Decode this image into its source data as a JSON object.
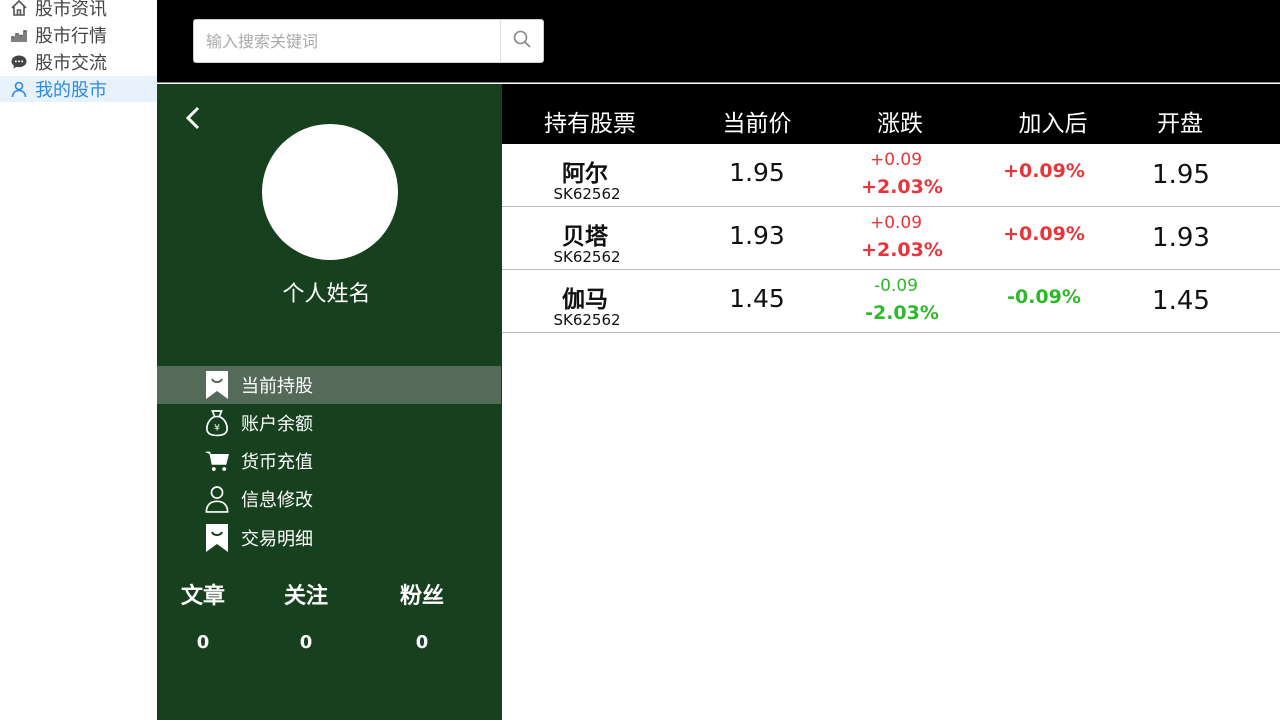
{
  "nav": {
    "items": [
      {
        "label": "股市资讯",
        "icon": "home-icon"
      },
      {
        "label": "股市行情",
        "icon": "chart-icon"
      },
      {
        "label": "股市交流",
        "icon": "chat-icon"
      },
      {
        "label": "我的股市",
        "icon": "user-icon",
        "active": true
      }
    ]
  },
  "search": {
    "placeholder": "输入搜索关键词",
    "value": ""
  },
  "profile": {
    "name": "个人姓名",
    "menu": [
      {
        "label": "当前持股",
        "icon": "bookmark-icon",
        "active": true
      },
      {
        "label": "账户余额",
        "icon": "money-bag-icon"
      },
      {
        "label": "货币充值",
        "icon": "cart-icon"
      },
      {
        "label": "信息修改",
        "icon": "person-icon"
      },
      {
        "label": "交易明细",
        "icon": "bookmark-icon"
      }
    ],
    "stats": [
      {
        "label": "文章",
        "value": "0"
      },
      {
        "label": "关注",
        "value": "0"
      },
      {
        "label": "粉丝",
        "value": "0"
      }
    ]
  },
  "table": {
    "headers": [
      "持有股票",
      "当前价",
      "涨跌",
      "加入后",
      "开盘"
    ],
    "rows": [
      {
        "name": "阿尔",
        "code": "SK62562",
        "price": "1.95",
        "change": "+0.09",
        "change_pct": "+2.03%",
        "after": "+0.09%",
        "open": "1.95",
        "trend": "up"
      },
      {
        "name": "贝塔",
        "code": "SK62562",
        "price": "1.93",
        "change": "+0.09",
        "change_pct": "+2.03%",
        "after": "+0.09%",
        "open": "1.93",
        "trend": "up"
      },
      {
        "name": "伽马",
        "code": "SK62562",
        "price": "1.45",
        "change": "-0.09",
        "change_pct": "-2.03%",
        "after": "-0.09%",
        "open": "1.45",
        "trend": "down"
      }
    ]
  },
  "colors": {
    "panel": "#17401f",
    "up": "#e8343b",
    "down": "#2fb82a",
    "active_nav": "#2a8ae6"
  }
}
